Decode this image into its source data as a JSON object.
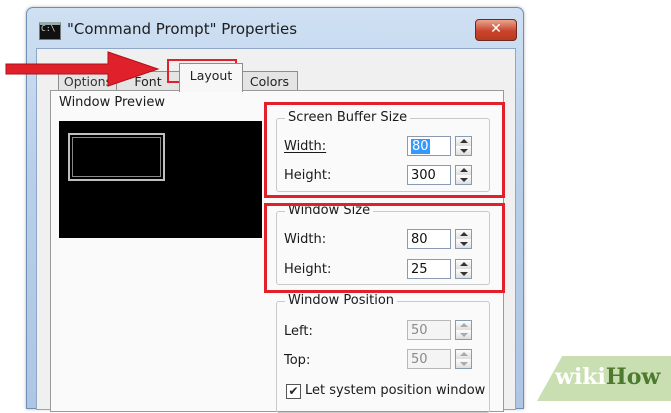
{
  "window": {
    "title": "\"Command Prompt\" Properties",
    "close_glyph": "✕"
  },
  "tabs": [
    {
      "label": "Options",
      "active": false
    },
    {
      "label": "Font",
      "active": false
    },
    {
      "label": "Layout",
      "active": true
    },
    {
      "label": "Colors",
      "active": false
    }
  ],
  "preview": {
    "label": "Window Preview"
  },
  "screen_buffer": {
    "label": "Screen Buffer Size",
    "width_label": "Width:",
    "width_value": "80",
    "height_label": "Height:",
    "height_value": "300"
  },
  "window_size": {
    "label": "Window Size",
    "width_label": "Width:",
    "width_value": "80",
    "height_label": "Height:",
    "height_value": "25"
  },
  "window_position": {
    "label": "Window Position",
    "left_label": "Left:",
    "left_value": "50",
    "top_label": "Top:",
    "top_value": "50",
    "let_system_label": "Let system position window",
    "let_system_checked": true
  },
  "watermark": {
    "part1": "wiki",
    "part2": "How"
  },
  "colors": {
    "highlight": "#e0202a",
    "preview_bg": "#000000",
    "selection": "#3399ff"
  }
}
